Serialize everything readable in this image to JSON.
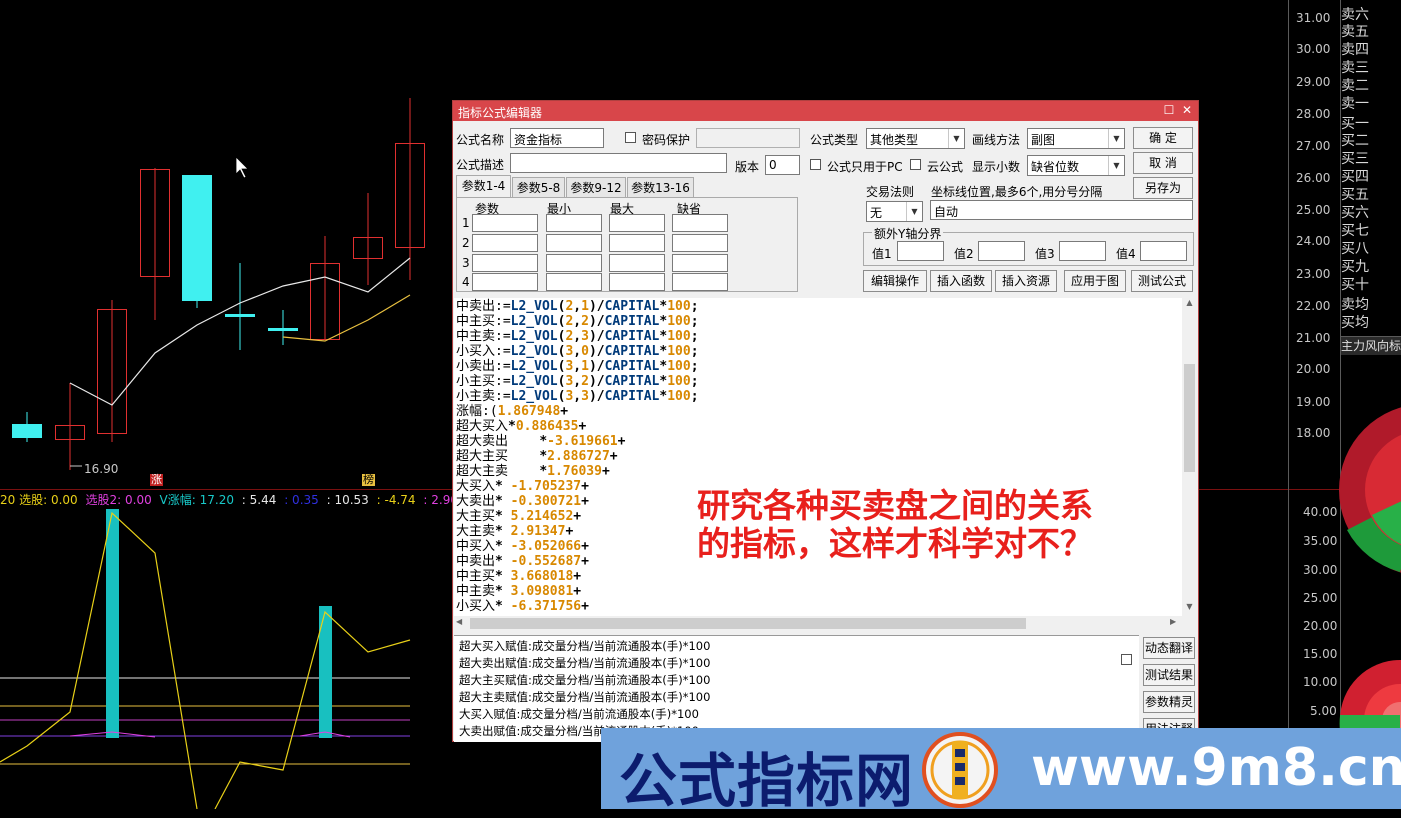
{
  "price_axis": {
    "labels": [
      "31.00",
      "30.00",
      "29.00",
      "28.00",
      "27.00",
      "26.00",
      "25.00",
      "24.00",
      "23.00",
      "22.00",
      "21.00",
      "20.00",
      "19.00",
      "18.00"
    ]
  },
  "indicator_axis": {
    "labels": [
      "40.00",
      "35.00",
      "30.00",
      "25.00",
      "20.00",
      "15.00",
      "10.00",
      "5.00"
    ]
  },
  "order_book": {
    "items": [
      "卖六",
      "卖五",
      "卖四",
      "卖三",
      "卖二",
      "卖一",
      "买一",
      "买二",
      "买三",
      "买四",
      "买五",
      "买六",
      "买七",
      "买八",
      "买九",
      "买十",
      "卖均",
      "买均"
    ],
    "panel_title": "主力风向标"
  },
  "main_chart": {
    "low_label": "16.90",
    "up_mark": "涨",
    "up_mark2": "榜"
  },
  "sub_chart": {
    "legend": [
      {
        "text": "20 选股: 0.00",
        "color": "#e8d018"
      },
      {
        "text": "选股2: 0.00",
        "color": "#e040e0"
      },
      {
        "text": "V涨幅: 17.20",
        "color": "#18c8c8"
      },
      {
        "text": ": 5.44",
        "color": "#e8e8e8"
      },
      {
        "text": ": 0.35",
        "color": "#3030e0"
      },
      {
        "text": ": 10.53",
        "color": "#e8e8e8"
      },
      {
        "text": ": -4.74",
        "color": "#e8d018"
      },
      {
        "text": ": 2.90",
        "color": "#e040e0"
      }
    ]
  },
  "dialog": {
    "title": "指标公式编辑器",
    "name_label": "公式名称",
    "name_value": "资金指标",
    "password_label": "密码保护",
    "type_label": "公式类型",
    "type_value": "其他类型",
    "draw_label": "画线方法",
    "draw_value": "副图",
    "ok_button": "确 定",
    "cancel_button": "取 消",
    "saveas_button": "另存为",
    "desc_label": "公式描述",
    "desc_value": "",
    "version_label": "版本",
    "version_value": "0",
    "pc_only_label": "公式只用于PC",
    "cloud_label": "云公式",
    "decimals_label": "显示小数",
    "decimals_value": "缺省位数",
    "tabs": [
      "参数1-4",
      "参数5-8",
      "参数9-12",
      "参数13-16"
    ],
    "param_headers": [
      "参数",
      "最小",
      "最大",
      "缺省"
    ],
    "param_rows": [
      "1",
      "2",
      "3",
      "4"
    ],
    "trade_rule_label": "交易法则",
    "trade_rule_value": "无",
    "coord_label": "坐标线位置,最多6个,用分号分隔",
    "coord_value": "自动",
    "extra_y_label": "额外Y轴分界",
    "val_labels": [
      "值1",
      "值2",
      "值3",
      "值4"
    ],
    "action_buttons": [
      "编辑操作",
      "插入函数",
      "插入资源",
      "应用于图",
      "测试公式"
    ],
    "side_buttons": [
      "动态翻译",
      "测试结果",
      "参数精灵",
      "用法注释"
    ]
  },
  "code_lines": [
    {
      "pre": "中卖出:=",
      "fn": "L2_VOL",
      "args": [
        "2",
        "1"
      ],
      "tail": "100"
    },
    {
      "pre": "中主买:=",
      "fn": "L2_VOL",
      "args": [
        "2",
        "2"
      ],
      "tail": "100"
    },
    {
      "pre": "中主卖:=",
      "fn": "L2_VOL",
      "args": [
        "2",
        "3"
      ],
      "tail": "100"
    },
    {
      "pre": "小买入:=",
      "fn": "L2_VOL",
      "args": [
        "3",
        "0"
      ],
      "tail": "100"
    },
    {
      "pre": "小卖出:=",
      "fn": "L2_VOL",
      "args": [
        "3",
        "1"
      ],
      "tail": "100"
    },
    {
      "pre": "小主买:=",
      "fn": "L2_VOL",
      "args": [
        "3",
        "2"
      ],
      "tail": "100"
    },
    {
      "pre": "小主卖:=",
      "fn": "L2_VOL",
      "args": [
        "3",
        "3"
      ],
      "tail": "100"
    }
  ],
  "capital_text": "CAPITAL",
  "coef_lines": [
    {
      "name": "涨幅:(",
      "op": "",
      "val": "1.867948",
      "end": "+"
    },
    {
      "name": "超大买入",
      "op": "*",
      "val": "0.886435",
      "end": "+"
    },
    {
      "name": "超大卖出",
      "op": "    *",
      "val": "-3.619661",
      "end": "+"
    },
    {
      "name": "超大主买",
      "op": "    *",
      "val": "2.886727",
      "end": "+"
    },
    {
      "name": "超大主卖",
      "op": "    *",
      "val": "1.76039",
      "end": "+"
    },
    {
      "name": "大买入",
      "op": "* ",
      "val": "-1.705237",
      "end": "+"
    },
    {
      "name": "大卖出",
      "op": "* ",
      "val": "-0.300721",
      "end": "+"
    },
    {
      "name": "大主买",
      "op": "* ",
      "val": "5.214652",
      "end": "+"
    },
    {
      "name": "大主卖",
      "op": "* ",
      "val": "2.91347",
      "end": "+"
    },
    {
      "name": "中买入",
      "op": "* ",
      "val": "-3.052066",
      "end": "+"
    },
    {
      "name": "中卖出",
      "op": "* ",
      "val": "-0.552687",
      "end": "+"
    },
    {
      "name": "中主买",
      "op": "* ",
      "val": "3.668018",
      "end": "+"
    },
    {
      "name": "中主卖",
      "op": "* ",
      "val": "3.098081",
      "end": "+"
    },
    {
      "name": "小买入",
      "op": "* ",
      "val": "-6.371756",
      "end": "+"
    }
  ],
  "desc_lines": [
    "超大买入赋值:成交量分档/当前流通股本(手)*100",
    "超大卖出赋值:成交量分档/当前流通股本(手)*100",
    "超大主买赋值:成交量分档/当前流通股本(手)*100",
    "超大主卖赋值:成交量分档/当前流通股本(手)*100",
    "大买入赋值:成交量分档/当前流通股本(手)*100",
    "大卖出赋值:成交量分档/当前流通股本(手)*100"
  ],
  "annotation": {
    "line1": "研究各种买卖盘之间的关系",
    "line2": "的指标，这样才科学对不？"
  },
  "banner": {
    "text": "公式指标网",
    "url": "www.9m8.cn"
  },
  "colors": {
    "up": "#e03030",
    "down": "#40f0f0",
    "accent_red": "#e8201c",
    "banner_bg": "#6fa2dc"
  }
}
